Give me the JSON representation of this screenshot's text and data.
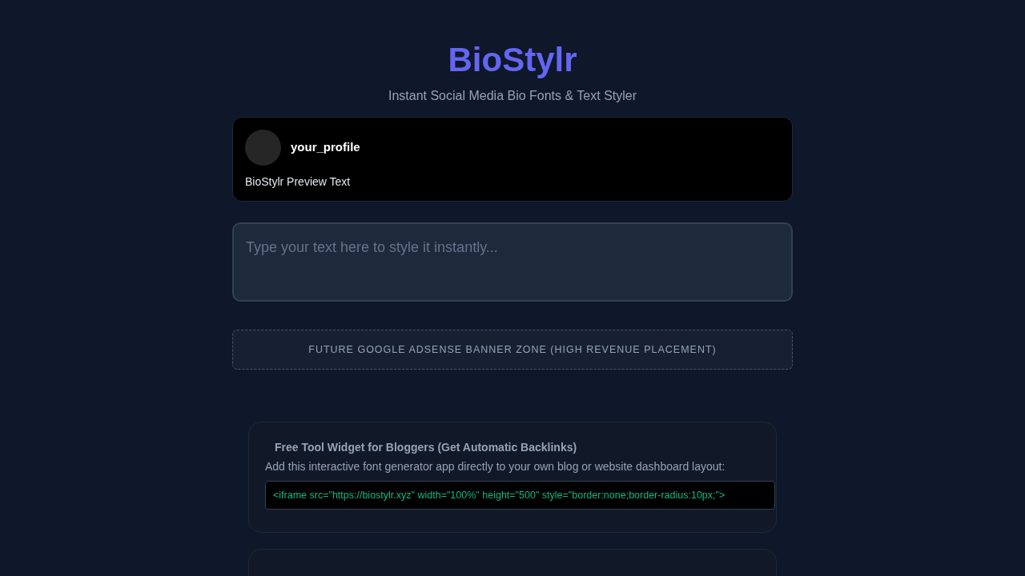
{
  "header": {
    "title": "BioStylr",
    "subtitle": "Instant Social Media Bio Fonts & Text Styler"
  },
  "preview": {
    "username": "your_profile",
    "bio": "BioStylr Preview Text"
  },
  "editor": {
    "placeholder": "Type your text here to style it instantly..."
  },
  "ad_banner": {
    "label": "FUTURE GOOGLE ADSENSE BANNER ZONE (HIGH REVENUE PLACEMENT)"
  },
  "widget": {
    "title": "Free Tool Widget for Bloggers (Get Automatic Backlinks)",
    "description": "Add this interactive font generator app directly to your own blog or website dashboard layout:",
    "embed_code": "<iframe src=\"https://biostylr.xyz\" width=\"100%\" height=\"500\" style=\"border:none;border-radius:10px;\">"
  }
}
